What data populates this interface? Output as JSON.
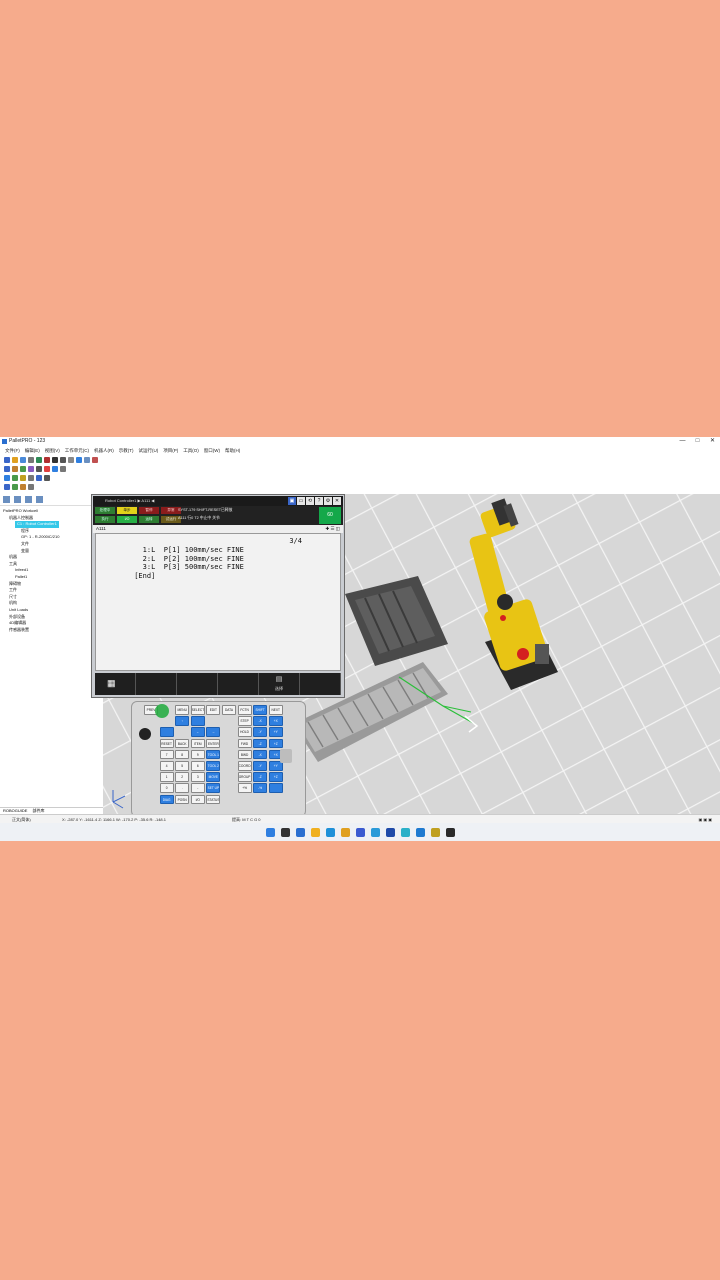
{
  "window": {
    "title": "PalletPRO - 123",
    "controls": [
      "—",
      "□",
      "✕"
    ]
  },
  "menu": [
    "文件(F)",
    "编辑(E)",
    "视图(V)",
    "工作单元(C)",
    "机器人(R)",
    "示教(T)",
    "试运行(U)",
    "项目(P)",
    "工具(O)",
    "窗口(W)",
    "帮助(H)"
  ],
  "tree": {
    "items": [
      {
        "label": "PalletPRO Workcell",
        "indent": 0
      },
      {
        "label": "机器人控制器",
        "indent": 1
      },
      {
        "label": "C1 : Robot Controller1",
        "indent": 2,
        "selected": true
      },
      {
        "label": "程序",
        "indent": 3
      },
      {
        "label": "GP: 1 - R-2000iC/210",
        "indent": 3
      },
      {
        "label": "文件",
        "indent": 3
      },
      {
        "label": "变量",
        "indent": 3
      },
      {
        "label": "机器",
        "indent": 1
      },
      {
        "label": "工具",
        "indent": 1
      },
      {
        "label": "Infeed1",
        "indent": 2
      },
      {
        "label": "Pallet1",
        "indent": 2
      },
      {
        "label": "障碍物",
        "indent": 1
      },
      {
        "label": "工件",
        "indent": 1
      },
      {
        "label": "尺寸",
        "indent": 1
      },
      {
        "label": "机构",
        "indent": 1
      },
      {
        "label": "Unit Loads",
        "indent": 1
      },
      {
        "label": "外部设备",
        "indent": 1
      },
      {
        "label": "4D编辑器",
        "indent": 1
      },
      {
        "label": "传感器装置",
        "indent": 1
      }
    ],
    "bottom_tabs": [
      "ROBOGUIDE",
      "部件库"
    ]
  },
  "pendant": {
    "title": "Robot Controller1 ▶ A111 ◀",
    "leds": [
      {
        "label": "处理中",
        "color": "#2e7d32"
      },
      {
        "label": "单步",
        "color": "#e2d21a"
      },
      {
        "label": "暂停",
        "color": "#8a1c1c"
      },
      {
        "label": "异常",
        "color": "#8a1c1c"
      },
      {
        "label": "执行",
        "color": "#2e7d32"
      },
      {
        "label": "I/O",
        "color": "#27b046"
      },
      {
        "label": "运转",
        "color": "#2e7d32"
      },
      {
        "label": "试运行",
        "color": "#6a5a1a"
      }
    ],
    "message": "SYST-179 SHIFT-RESET已释放",
    "message2": "A111 行0 T2 中止中 关节",
    "override": "60",
    "program_name": "A111",
    "line_indicator": "3/4",
    "lines": [
      "   1:L  P[1] 100mm/sec FINE",
      "   2:L  P[2] 100mm/sec FINE",
      "   3:L  P[3] 500mm/sec FINE",
      " [End]"
    ],
    "fkey_label": "选择",
    "keys": [
      "PREV",
      "F1",
      "MENU",
      "SELECT",
      "EDIT",
      "DATA",
      "FCTN",
      "SHIFT",
      "NEXT",
      "",
      "",
      "",
      "",
      "",
      "",
      "STEP",
      "",
      ""
    ]
  },
  "keypad": {
    "rows": [
      [
        "PREV",
        "",
        "MENU",
        "SELECT",
        "EDIT",
        "DATA",
        "FCTN",
        "SHIFT",
        "NEXT"
      ],
      [
        "",
        "",
        "↑",
        "",
        "",
        "",
        "STEP",
        "-X",
        "+X"
      ],
      [
        "",
        "",
        "",
        "",
        "←",
        "→",
        "HOLD",
        "-Y",
        "+Y"
      ],
      [
        "",
        "RESET",
        "BACK SPACE",
        "ITEM",
        "ENTER",
        "",
        "FWD",
        "-Z",
        "+Z"
      ],
      [
        "",
        "7",
        "8",
        "9",
        "TOOL 1",
        "",
        "BWD",
        "-X",
        "+X"
      ],
      [
        "",
        "4",
        "5",
        "6",
        "TOOL 2",
        "",
        "COORD",
        "-Y",
        "+Y"
      ],
      [
        "",
        "1",
        "2",
        "3",
        "MOVE MENU",
        "",
        "GROUP",
        "-Z",
        "+Z"
      ],
      [
        "",
        "0",
        ".",
        "-",
        "SET UP",
        "",
        "+%",
        "-%",
        ""
      ],
      [
        "",
        "DIAG HELP",
        "POSN",
        "I/O",
        "STATUS",
        "",
        "",
        "",
        ""
      ]
    ]
  },
  "statusbar": {
    "language": "正文(简体)",
    "coords": "X: -287.0  Y: -1611.4  Z: 1166.1  W: -170.2  P: -35.6  R: -148.1",
    "right": "提高: M T C G 0"
  }
}
